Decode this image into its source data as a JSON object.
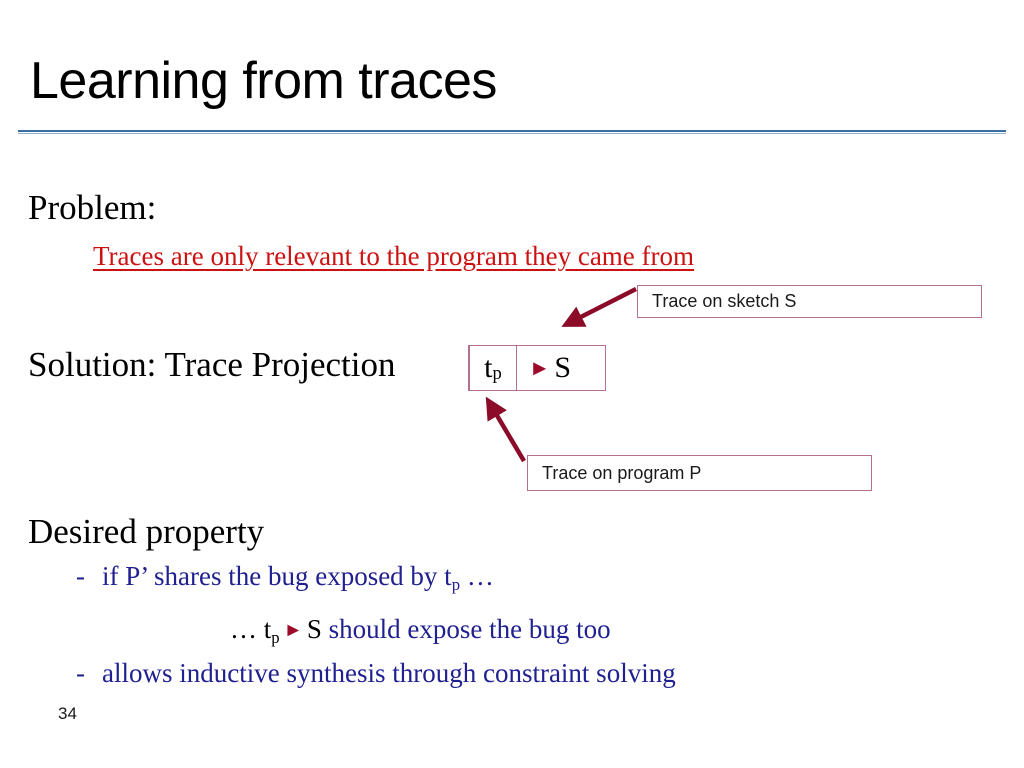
{
  "slide": {
    "title": "Learning from traces",
    "page_number": "34",
    "accent_rule_color": "#3a6ea5",
    "callout_border_color": "#b4708c",
    "problem_color": "#cc1111",
    "bullet_color": "#202090",
    "arrow_color": "#8b0b28"
  },
  "problem": {
    "heading": "Problem:",
    "detail": "Traces are only relevant to the program they came from"
  },
  "solution": {
    "label": "Solution: Trace Projection",
    "formula": {
      "trace_base": "t",
      "trace_sub": "p",
      "operator": "►",
      "sketch": "S"
    }
  },
  "callouts": [
    {
      "id": "trace-on-sketch",
      "text": "Trace on sketch S"
    },
    {
      "id": "trace-on-program",
      "text": "Trace on program P"
    }
  ],
  "desired_property": {
    "heading": "Desired property",
    "bullets": [
      {
        "dash": "-",
        "pre": "if P’ shares the bug exposed by t",
        "sub": "p",
        "post": " …"
      },
      {
        "lead": "… t",
        "sub": "p",
        "operator": "►",
        "sketch": "S",
        "rest": " should expose the bug too"
      },
      {
        "dash": "-",
        "text": "allows inductive synthesis through constraint solving"
      }
    ]
  }
}
